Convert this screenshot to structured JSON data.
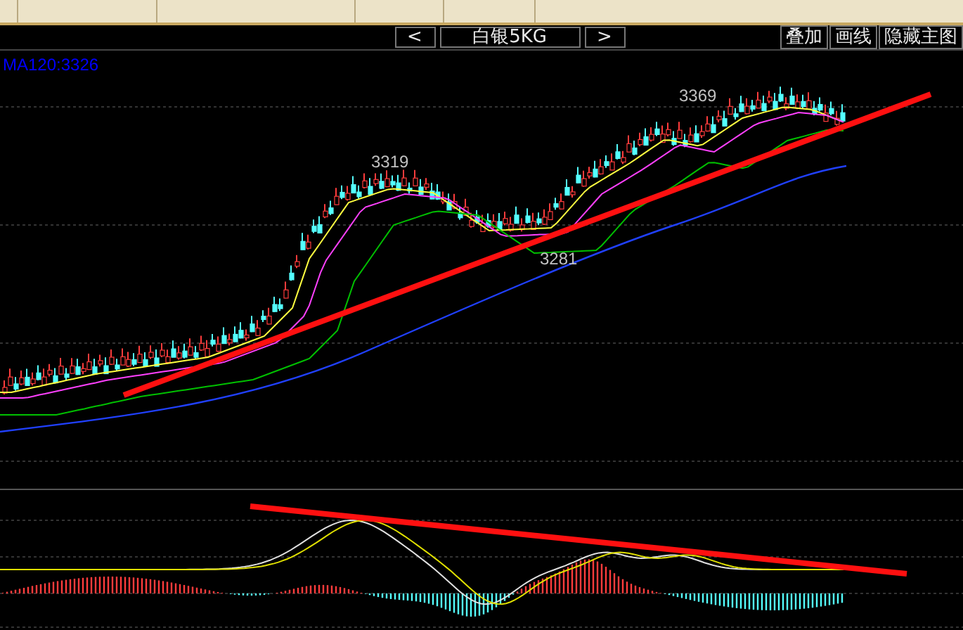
{
  "toolbar": {
    "prev": "<",
    "title": "白银5KG",
    "next": ">",
    "buttons": [
      "叠加",
      "画线",
      "隐藏主图"
    ]
  },
  "indicator": "MA120:3326",
  "annotations": [
    {
      "text": "3319"
    },
    {
      "text": "3281"
    },
    {
      "text": "3369"
    }
  ]
}
